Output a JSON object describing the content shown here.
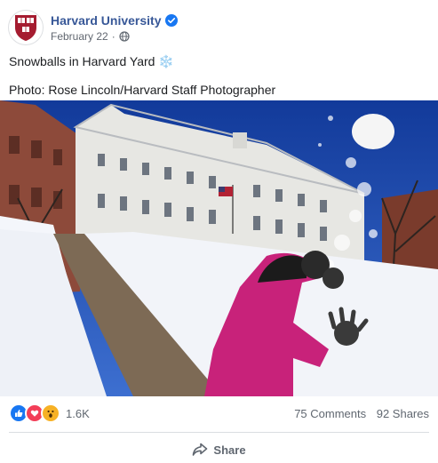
{
  "post": {
    "page_name": "Harvard University",
    "date": "February 22",
    "dot": "·",
    "caption_line1": "Snowballs in Harvard Yard",
    "snowflake": "❄️",
    "caption_line2": "Photo: Rose Lincoln/Harvard Staff Photographer"
  },
  "stats": {
    "reactions_count": "1.6K",
    "comments": "75 Comments",
    "shares": "92 Shares"
  },
  "actions": {
    "share_label": "Share"
  },
  "colors": {
    "link": "#385898",
    "like_blue": "#1877f2",
    "love_red": "#f33e58",
    "wow_yellow": "#f7b125",
    "harvard_crimson": "#a51c30"
  },
  "icons": [
    "harvard-shield-icon",
    "verified-badge-icon",
    "globe-icon",
    "like-reaction-icon",
    "love-reaction-icon",
    "wow-reaction-icon",
    "share-arrow-icon"
  ]
}
